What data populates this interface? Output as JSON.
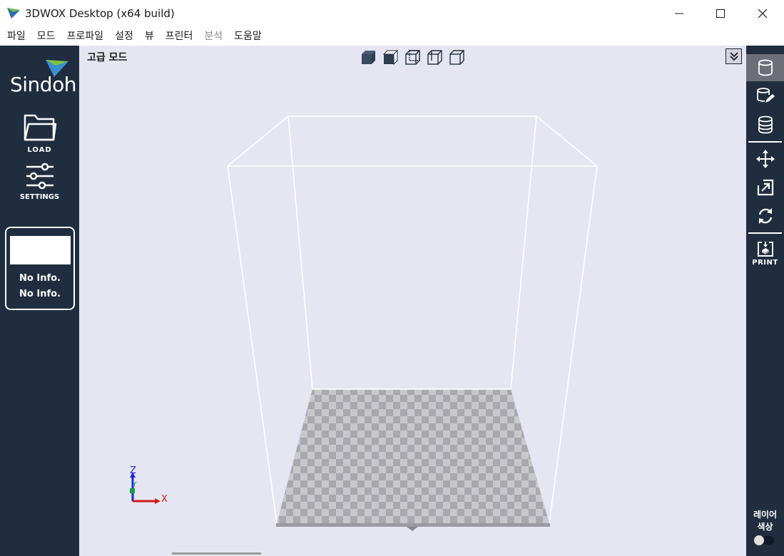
{
  "window": {
    "title": "3DWOX Desktop (x64 build)"
  },
  "menu": {
    "items": [
      {
        "label": "파일",
        "enabled": true
      },
      {
        "label": "모드",
        "enabled": true
      },
      {
        "label": "프로파일",
        "enabled": true
      },
      {
        "label": "설정",
        "enabled": true
      },
      {
        "label": "뷰",
        "enabled": true
      },
      {
        "label": "프린터",
        "enabled": true
      },
      {
        "label": "분석",
        "enabled": false
      },
      {
        "label": "도움말",
        "enabled": true
      }
    ]
  },
  "left_sidebar": {
    "brand": "Sindoh",
    "load_label": "LOAD",
    "settings_label": "SETTINGS",
    "info": {
      "line1": "No Info.",
      "line2": "No Info."
    }
  },
  "viewport": {
    "mode_label": "고급 모드",
    "view_buttons": [
      "view-solid-front",
      "view-solid-side",
      "view-wire-front",
      "view-wire-side",
      "view-wire-top"
    ],
    "axis": {
      "z": "Z",
      "y": "Y",
      "x": "X"
    },
    "colors": {
      "background": "#e6e6f2",
      "bed_light": "#c8c8cc",
      "bed_dark": "#a8a8ae",
      "frame": "#ffffff"
    }
  },
  "right_sidebar": {
    "tools": [
      "model-view-icon",
      "edit-model-icon",
      "layers-icon",
      "move-icon",
      "scale-icon",
      "rotate-icon",
      "print-icon"
    ],
    "print_label": "PRINT",
    "layer_color_label_1": "레이어",
    "layer_color_label_2": "색상",
    "layer_color_toggle": false
  },
  "theme": {
    "sidebar": "#1f2d3f",
    "active_tool": "#6e6e78"
  }
}
